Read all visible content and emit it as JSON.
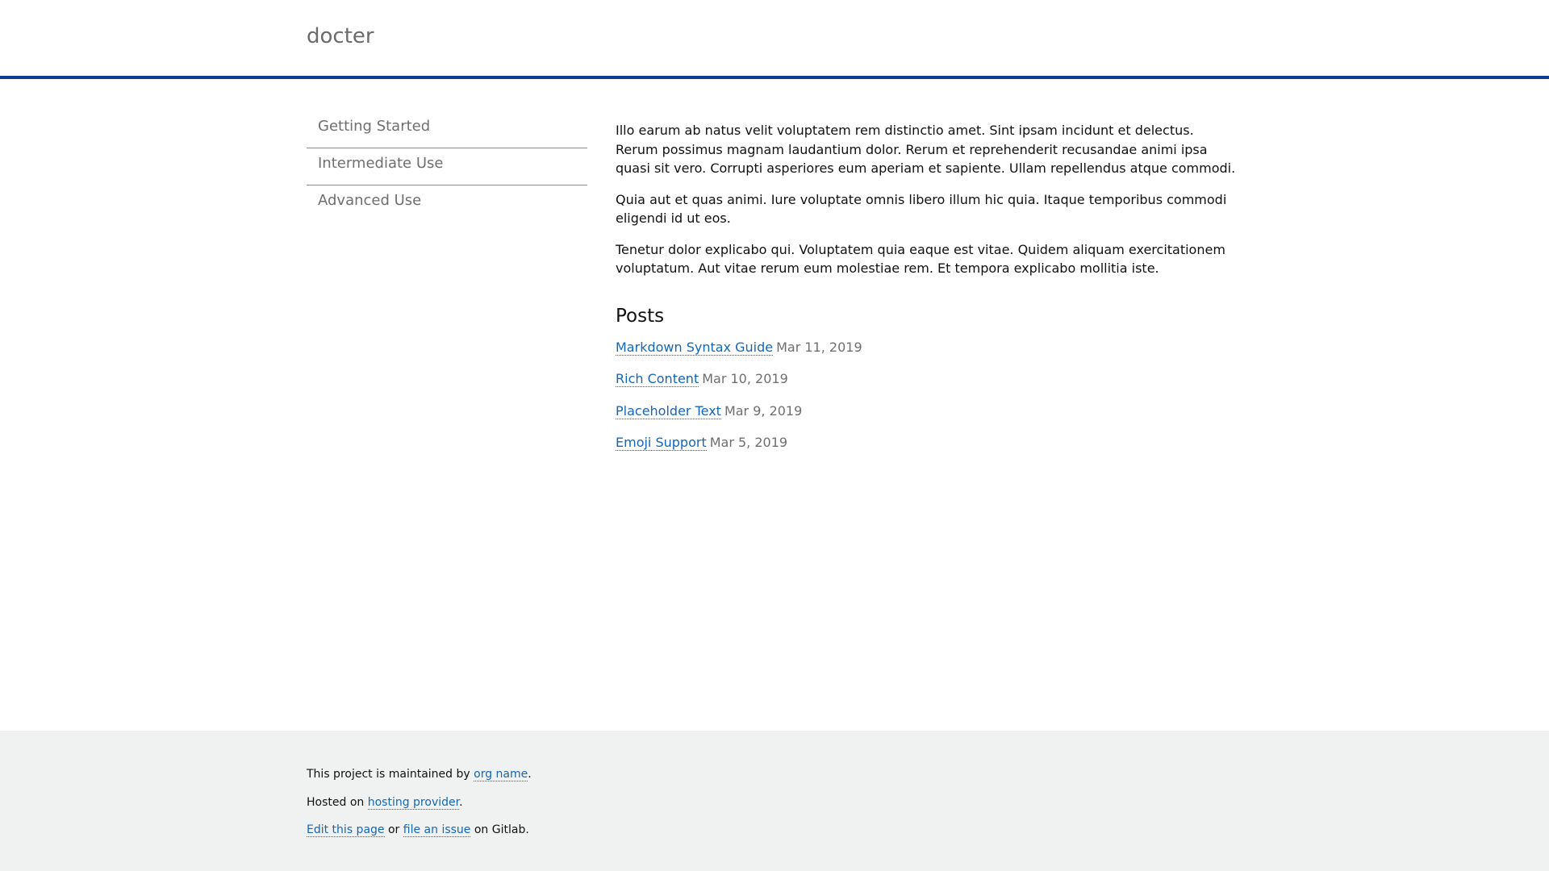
{
  "header": {
    "brand": "docter"
  },
  "sidebar": {
    "items": [
      {
        "label": "Getting Started"
      },
      {
        "label": "Intermediate Use"
      },
      {
        "label": "Advanced Use"
      }
    ]
  },
  "main": {
    "paragraphs": [
      "Illo earum ab natus velit voluptatem rem distinctio amet. Sint ipsam incidunt et delectus. Rerum possimus magnam laudantium dolor. Rerum et reprehenderit recusandae animi ipsa quasi sit vero. Corrupti asperiores eum aperiam et sapiente. Ullam repellendus atque commodi.",
      "Quia aut et quas animi. Iure voluptate omnis libero illum hic quia. Itaque temporibus commodi eligendi id ut eos.",
      "Tenetur dolor explicabo qui. Voluptatem quia eaque est vitae. Quidem aliquam exercitationem voluptatum. Aut vitae rerum eum molestiae rem. Et tempora explicabo mollitia iste."
    ],
    "posts_heading": "Posts",
    "posts": [
      {
        "title": "Markdown Syntax Guide",
        "date": "Mar 11, 2019"
      },
      {
        "title": "Rich Content",
        "date": "Mar 10, 2019"
      },
      {
        "title": "Placeholder Text",
        "date": "Mar 9, 2019"
      },
      {
        "title": "Emoji Support",
        "date": "Mar 5, 2019"
      }
    ]
  },
  "footer": {
    "line1_prefix": "This project is maintained by ",
    "line1_link": "org name",
    "line1_suffix": ".",
    "line2_prefix": "Hosted on ",
    "line2_link": "hosting provider",
    "line2_suffix": ".",
    "line3_link1": "Edit this page",
    "line3_middle": " or ",
    "line3_link2": "file an issue",
    "line3_suffix": " on Gitlab."
  },
  "colors": {
    "accent": "#0b3a9a",
    "link": "#1466b8",
    "muted_text": "#6f6f6f",
    "footer_bg": "#f0f2f2"
  }
}
